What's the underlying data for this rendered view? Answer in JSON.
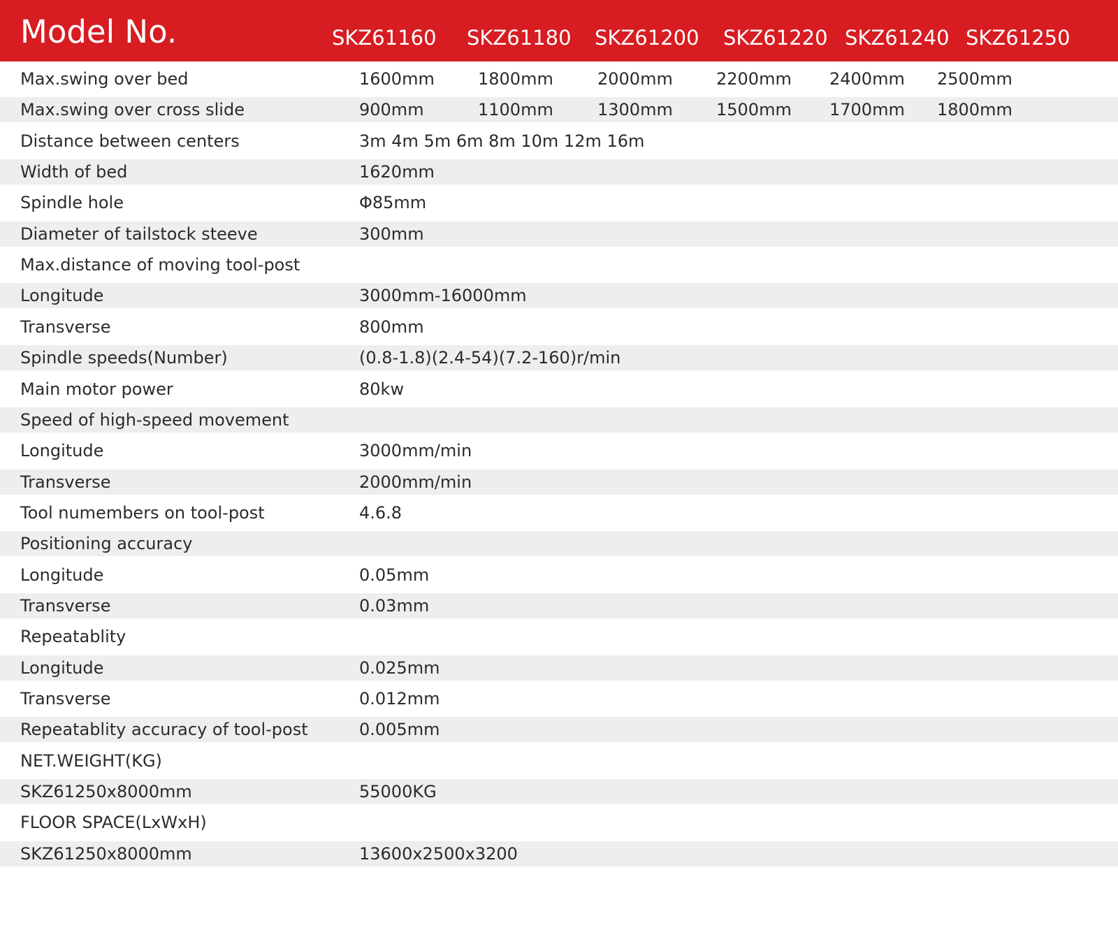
{
  "header": {
    "title": "Model No.",
    "models": [
      "SKZ61160",
      "SKZ61180",
      "SKZ61200",
      "SKZ61220",
      "SKZ61240",
      "SKZ61250"
    ]
  },
  "colors": {
    "header_bg": "#d71c22",
    "header_text": "#ffffff",
    "row_stripe": "#eeeeee",
    "text": "#2b2b2b"
  },
  "rows": [
    {
      "label": "Max.swing over bed",
      "values": [
        "1600mm",
        "1800mm",
        "2000mm",
        "2200mm",
        "2400mm",
        "2500mm"
      ]
    },
    {
      "label": "Max.swing over cross slide",
      "values": [
        "900mm",
        "1100mm",
        "1300mm",
        "1500mm",
        "1700mm",
        "1800mm"
      ]
    },
    {
      "label": "Distance between centers",
      "values": [
        "3m 4m 5m 6m 8m 10m 12m 16m"
      ]
    },
    {
      "label": "Width of bed",
      "values": [
        "1620mm"
      ]
    },
    {
      "label": "Spindle hole",
      "values": [
        "Φ85mm"
      ]
    },
    {
      "label": "Diameter of tailstock steeve",
      "values": [
        "300mm"
      ]
    },
    {
      "label": "Max.distance of moving tool-post",
      "values": []
    },
    {
      "label": "Longitude",
      "values": [
        "3000mm-16000mm"
      ]
    },
    {
      "label": "Transverse",
      "values": [
        "800mm"
      ]
    },
    {
      "label": "Spindle speeds(Number)",
      "values": [
        "(0.8-1.8)(2.4-54)(7.2-160)r/min"
      ]
    },
    {
      "label": "Main motor power",
      "values": [
        "80kw"
      ]
    },
    {
      "label": "Speed of high-speed movement",
      "values": []
    },
    {
      "label": "Longitude",
      "values": [
        "3000mm/min"
      ]
    },
    {
      "label": "Transverse",
      "values": [
        "2000mm/min"
      ]
    },
    {
      "label": "Tool numembers on tool-post",
      "values": [
        "4.6.8"
      ]
    },
    {
      "label": "Positioning accuracy",
      "values": []
    },
    {
      "label": "Longitude",
      "values": [
        "0.05mm"
      ]
    },
    {
      "label": "Transverse",
      "values": [
        "0.03mm"
      ]
    },
    {
      "label": "Repeatablity",
      "values": []
    },
    {
      "label": "Longitude",
      "values": [
        "0.025mm"
      ]
    },
    {
      "label": "Transverse",
      "values": [
        "0.012mm"
      ]
    },
    {
      "label": "Repeatablity accuracy of tool-post",
      "values": [
        "0.005mm"
      ]
    },
    {
      "label": "NET.WEIGHT(KG)",
      "values": []
    },
    {
      "label": "SKZ61250x8000mm",
      "values": [
        "55000KG"
      ]
    },
    {
      "label": "FLOOR SPACE(LxWxH)",
      "values": []
    },
    {
      "label": "SKZ61250x8000mm",
      "values": [
        "13600x2500x3200"
      ]
    }
  ]
}
